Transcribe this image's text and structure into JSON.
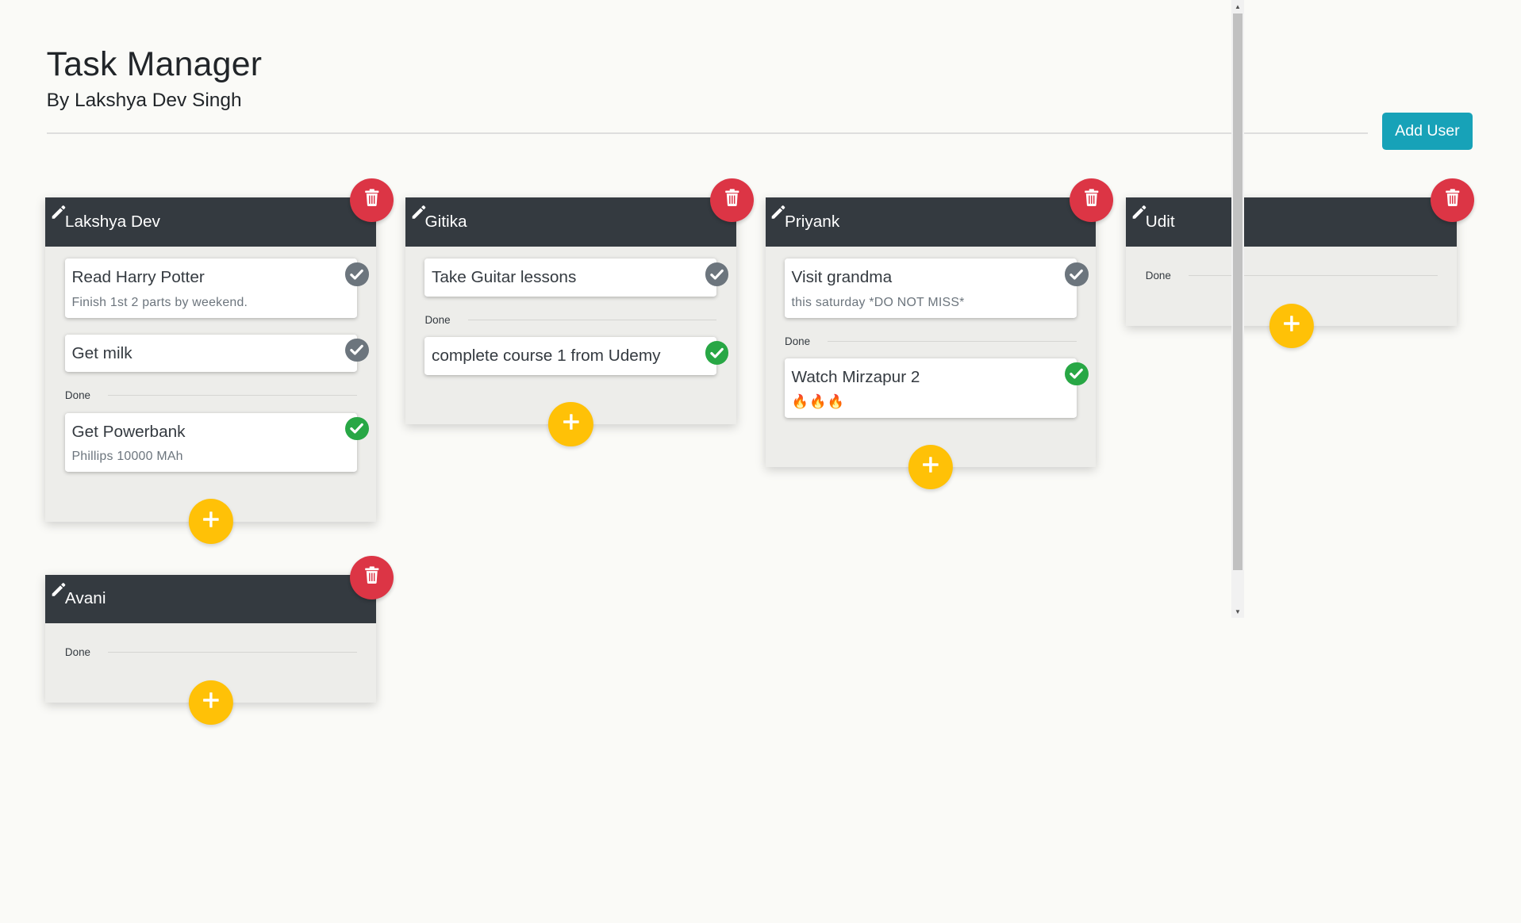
{
  "header": {
    "title": "Task Manager",
    "subtitle": "By Lakshya Dev Singh",
    "add_user_label": "Add User"
  },
  "done_label": "Done",
  "users": [
    {
      "name": "Lakshya Dev",
      "tasks": [
        {
          "title": "Read Harry Potter",
          "description": "Finish 1st 2 parts by weekend.",
          "done": false
        },
        {
          "title": "Get milk",
          "description": "",
          "done": false
        }
      ],
      "done_tasks": [
        {
          "title": "Get Powerbank",
          "description": "Phillips 10000 MAh",
          "done": true
        }
      ]
    },
    {
      "name": "Gitika",
      "tasks": [
        {
          "title": "Take Guitar lessons",
          "description": "",
          "done": false
        }
      ],
      "done_tasks": [
        {
          "title": "complete course 1 from Udemy",
          "description": "",
          "done": true
        }
      ]
    },
    {
      "name": "Priyank",
      "tasks": [
        {
          "title": "Visit grandma",
          "description": "this saturday *DO NOT MISS*",
          "done": false
        }
      ],
      "done_tasks": [
        {
          "title": "Watch Mirzapur 2",
          "description": "🔥🔥🔥",
          "done": true
        }
      ]
    },
    {
      "name": "Udit",
      "tasks": [],
      "done_tasks": []
    },
    {
      "name": "Avani",
      "tasks": [],
      "done_tasks": []
    }
  ],
  "colors": {
    "header_bg": "#343a40",
    "delete": "#dc3545",
    "add_task": "#ffc107",
    "add_user": "#17a2b8",
    "check_pending": "#6c757d",
    "check_done": "#28a745"
  },
  "icons": {
    "edit": "pencil-icon",
    "delete": "trash-icon",
    "check": "check-icon",
    "add": "plus-icon"
  }
}
